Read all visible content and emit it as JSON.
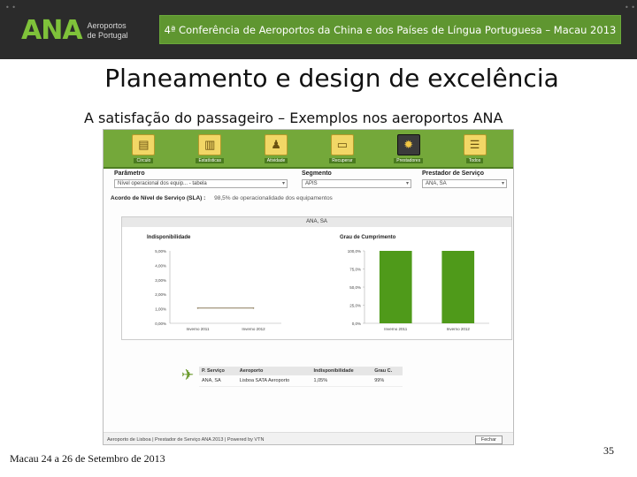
{
  "header": {
    "logo_mark": "ANA",
    "logo_line1": "Aeroportos",
    "logo_line2": "de Portugal",
    "conference": "4ª Conferência de Aeroportos da China e dos Países de Língua Portuguesa – Macau 2013"
  },
  "slide": {
    "title": "Planeamento e design de excelência",
    "subtitle": "A satisfação do passageiro – Exemplos nos aeroportos ANA"
  },
  "app": {
    "toolbar": [
      {
        "label": "Círculo",
        "icon": "chart-icon"
      },
      {
        "label": "Estatísticas",
        "icon": "stats-icon"
      },
      {
        "label": "Atividade",
        "icon": "person-icon"
      },
      {
        "label": "Recuperar",
        "icon": "folder-icon"
      },
      {
        "label": "Prestadores",
        "icon": "gear-icon"
      },
      {
        "label": "Todos",
        "icon": "list-icon"
      }
    ],
    "filters": {
      "parametro_label": "Parâmetro",
      "parametro_value": "Nível operacional dos equip... - tabela",
      "segmento_label": "Segmento",
      "segmento_value": "APIS",
      "prestador_label": "Prestador de Serviço",
      "prestador_value": "ANA, SA"
    },
    "sla": {
      "label": "Acordo de Nível de Serviço (SLA) :",
      "value": "98,5% de operacionalidade dos equipamentos"
    },
    "panel_title": "ANA, SA",
    "table": {
      "headers": [
        "P. Serviço",
        "Aeroporto",
        "Indisponibilidade",
        "Grau C."
      ],
      "rows": [
        [
          "ANA, SA",
          "Lisboa SATA Aeroporto",
          "1,05%",
          "99%"
        ]
      ]
    },
    "footer": "Aeroporto de Lisboa | Prestador de Serviço ANA 2013 | Powered by VTN",
    "close_label": "Fechar"
  },
  "chart_data": [
    {
      "type": "line",
      "title": "Indisponibilidade",
      "categories": [
        "Inverno 2011",
        "Inverno 2012"
      ],
      "yticks": [
        "0,00%",
        "1,00%",
        "2,00%",
        "3,00%",
        "4,00%",
        "5,00%"
      ],
      "series": [
        {
          "values": [
            1.05,
            1.05
          ]
        }
      ],
      "ylim": [
        0,
        5
      ]
    },
    {
      "type": "bar",
      "title": "Grau de Cumprimento",
      "categories": [
        "Inverno 2011",
        "Inverno 2012"
      ],
      "yticks": [
        "0,0%",
        "25,0%",
        "50,0%",
        "75,0%",
        "100,0%"
      ],
      "values": [
        100,
        100
      ],
      "ylim": [
        0,
        100
      ],
      "color": "#4f9a1a"
    }
  ],
  "footer": {
    "left": "Macau 24 a 26 de Setembro de 2013",
    "page": "35"
  }
}
